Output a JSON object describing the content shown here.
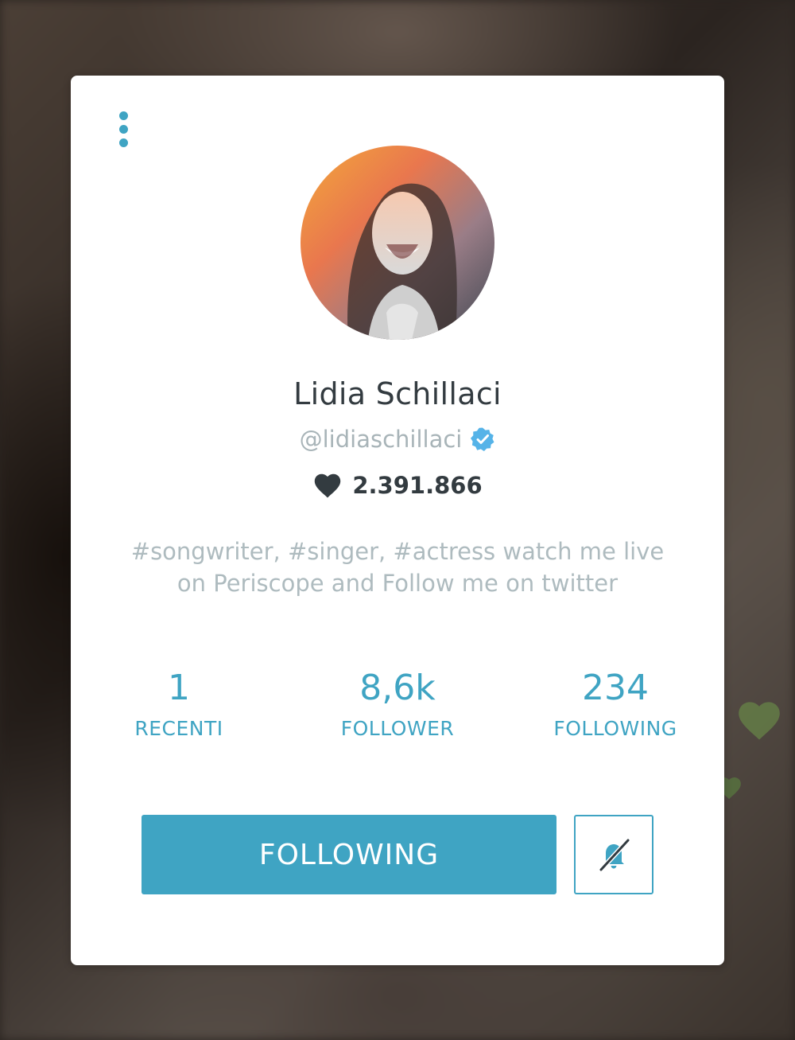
{
  "profile": {
    "name": "Lidia Schillaci",
    "handle": "@lidiaschillaci",
    "verified": true,
    "hearts": "2.391.866",
    "bio": "#songwriter, #singer, #actress  watch me live on Periscope and Follow me on twitter"
  },
  "stats": [
    {
      "value": "1",
      "label": "RECENTI"
    },
    {
      "value": "8,6k",
      "label": "FOLLOWER"
    },
    {
      "value": "234",
      "label": "FOLLOWING"
    }
  ],
  "actions": {
    "follow_label": "FOLLOWING",
    "mute_icon": "bell-muted-icon"
  },
  "colors": {
    "accent": "#3fa4c3",
    "name_text": "#333b40",
    "muted_text": "#aebbbf"
  }
}
